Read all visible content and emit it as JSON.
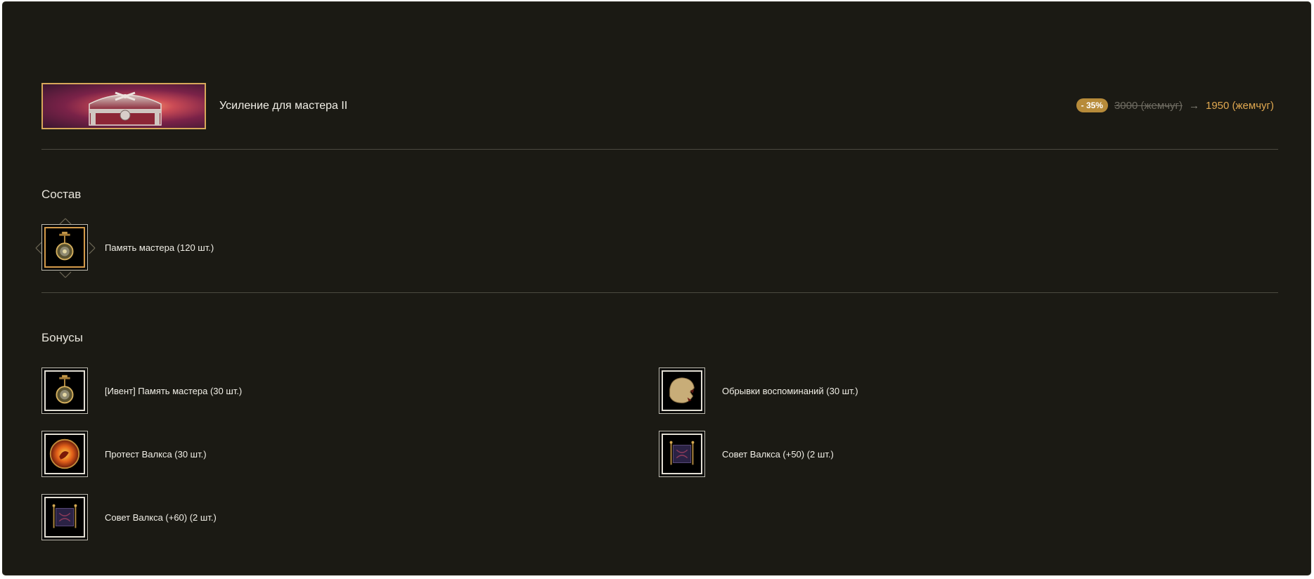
{
  "product": {
    "title": "Усиление для мастера II",
    "discount": "- 35%",
    "old_price": "3000 (жемчуг)",
    "arrow": "→",
    "new_price": "1950 (жемчуг)"
  },
  "composition": {
    "title": "Состав",
    "items": [
      {
        "label": "Память мастера (120 шт.)",
        "icon": "pendant-icon"
      }
    ]
  },
  "bonuses": {
    "title": "Бонусы",
    "items": [
      {
        "label": "[Ивент] Память мастера (30 шт.)",
        "icon": "pendant-icon"
      },
      {
        "label": "Обрывки воспоминаний (30 шт.)",
        "icon": "torn-parchment-icon"
      },
      {
        "label": "Протест Валкса (30 шт.)",
        "icon": "fire-orb-icon"
      },
      {
        "label": "Совет Валкса (+50) (2 шт.)",
        "icon": "scroll-icon"
      },
      {
        "label": "Совет Валкса (+60) (2 шт.)",
        "icon": "scroll-icon"
      }
    ]
  },
  "colors": {
    "panel": "#1b1a14",
    "accent_gold": "#e0a850",
    "discount_badge": "#b78b3a",
    "divider": "#4c4a40"
  }
}
